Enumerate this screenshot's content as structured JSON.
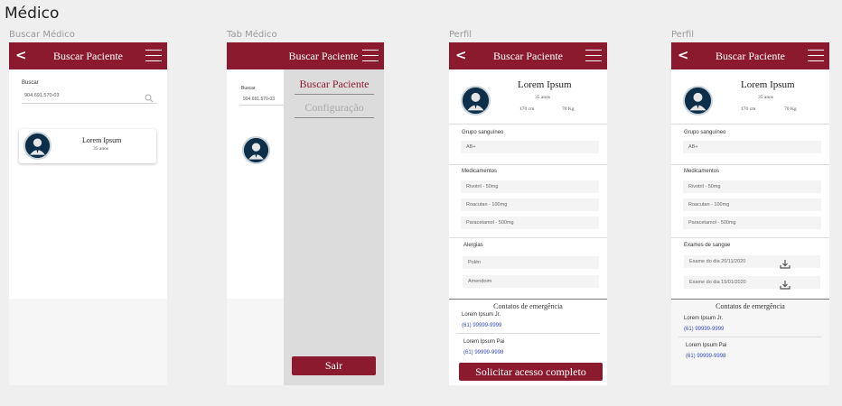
{
  "page_title": "Médico",
  "frames": {
    "f1": {
      "label": "Buscar Médico",
      "appbar": {
        "back": "<",
        "title": "Buscar Paciente"
      },
      "search": {
        "label": "Buscar",
        "value": "904.691.570-03"
      },
      "result": {
        "name": "Lorem Ipsum",
        "age": "35 anos"
      }
    },
    "f2": {
      "label": "Tab Médico",
      "appbar": {
        "title": "Buscar Paciente"
      },
      "search": {
        "label": "Buscar",
        "value": "904.691.570-03"
      },
      "menu": {
        "item1": "Buscar Paciente",
        "item2": "Configuração",
        "exit": "Sair"
      }
    },
    "f3": {
      "label": "Perfil",
      "appbar": {
        "back": "<",
        "title": "Buscar Paciente"
      },
      "profile": {
        "name": "Lorem Ipsum",
        "age": "35 anos",
        "height": "170 cm",
        "weight": "70 Kg"
      },
      "blood_label": "Grupo sanguíneo",
      "blood_value": "AB+",
      "meds_label": "Medicamentos",
      "meds": [
        "Rivotril  -  50mg",
        "Roacutan - 100mg",
        "Paracetamol - 500mg"
      ],
      "allergy_label": "Alergias",
      "allergies": [
        "Polén",
        "Amendoim"
      ],
      "contacts_title": "Contatos de emergência",
      "contacts": [
        {
          "name": "Lorem Ipsum Jr.",
          "phone": "(61) 99999-9999"
        },
        {
          "name": "Lorem Ipsum Pai",
          "phone": "(61) 99999-9998"
        }
      ],
      "request_button": "Solicitar acesso completo"
    },
    "f4": {
      "label": "Perfil",
      "appbar": {
        "back": "<",
        "title": "Buscar Paciente"
      },
      "profile": {
        "name": "Lorem Ipsum",
        "age": "35 anos",
        "height": "170 cm",
        "weight": "70 Kg"
      },
      "blood_label": "Grupo sanguíneo",
      "blood_value": "AB+",
      "meds_label": "Medicamentos",
      "meds": [
        "Rivotril  -  50mg",
        "Roacutan - 100mg",
        "Paracetamol - 500mg"
      ],
      "exams_label": "Exames de sangue",
      "exams": [
        "Exame do dia 20/11/2020",
        "Exame do dia 15/01/2020"
      ],
      "contacts_title": "Contatos de emergência",
      "contacts": [
        {
          "name": "Lorem Ipsum Jr.",
          "phone": "(61) 99999-9999"
        },
        {
          "name": "Lorem Ipsum Pai",
          "phone": "(61) 99999-9998"
        }
      ]
    }
  },
  "colors": {
    "brand": "#8b1a2f",
    "link": "#3a4fc2",
    "drawer": "#dcdcdc"
  },
  "icons": {
    "back": "chevron-left-icon",
    "menu": "hamburger-menu-icon",
    "search": "search-icon",
    "download": "download-icon",
    "avatar": "user-avatar-icon"
  }
}
